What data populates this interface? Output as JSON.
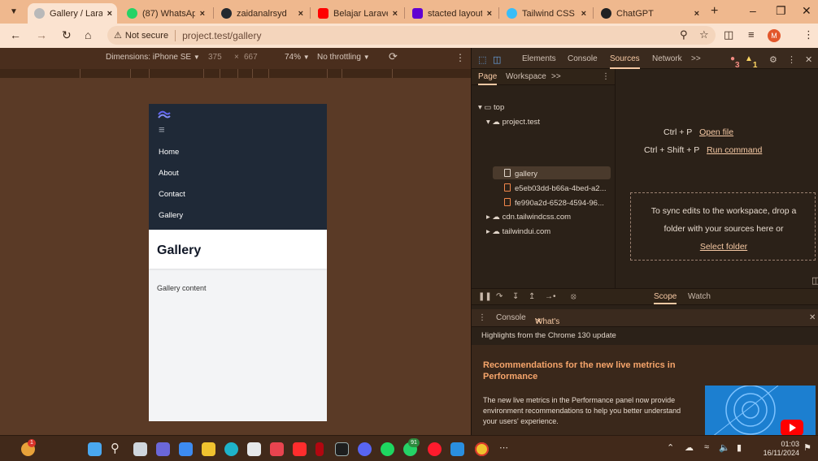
{
  "browser": {
    "tabs": [
      {
        "title": "Gallery / Larav",
        "active": true
      },
      {
        "title": "(87) WhatsAp",
        "active": false
      },
      {
        "title": "zaidanalrsyd",
        "active": false
      },
      {
        "title": "Belajar Laravel",
        "active": false
      },
      {
        "title": "stacted layout",
        "active": false
      },
      {
        "title": "Tailwind CSS",
        "active": false
      },
      {
        "title": "ChatGPT",
        "active": false
      }
    ],
    "address": {
      "security": "Not secure",
      "url": "project.test/gallery"
    },
    "profile_initial": "M"
  },
  "device_toolbar": {
    "dimensions_label": "Dimensions: iPhone SE",
    "width": "375",
    "times": "×",
    "height": "667",
    "zoom": "74%",
    "throttling": "No throttling"
  },
  "mobile_page": {
    "nav_links": [
      "Home",
      "About",
      "Contact",
      "Gallery"
    ],
    "page_title": "Gallery",
    "content": "Gallery content"
  },
  "devtools": {
    "tabs": [
      "Elements",
      "Console",
      "Sources",
      "Network"
    ],
    "more": ">>",
    "error_count": "3",
    "warning_count": "1",
    "sources_subtabs": [
      "Page",
      "Workspace"
    ],
    "tree": {
      "top": "top",
      "origin": "project.test",
      "files": [
        "gallery",
        "e5eb03dd-b66a-4bed-a2...",
        "fe990a2d-6528-4594-96..."
      ],
      "other_origins": [
        "cdn.tailwindcss.com",
        "tailwindui.com"
      ]
    },
    "editor": {
      "shortcut1_keys": "Ctrl + P",
      "shortcut1_action": "Open file",
      "shortcut2_keys": "Ctrl + Shift + P",
      "shortcut2_action": "Run command",
      "drop_line1": "To sync edits to the workspace, drop a",
      "drop_line2": "folder with your sources here or",
      "select_folder": "Select folder"
    },
    "debugger_tabs": [
      "Scope",
      "Watch"
    ],
    "drawer": {
      "tabs": [
        "Console",
        "What's new"
      ],
      "highlights": "Highlights from the Chrome 130 update",
      "card_title": "Recommendations for the new live metrics in Performance",
      "card_body": "The new live metrics in the Performance panel now provide environment recommendations to help you better understand your users' experience."
    }
  },
  "taskbar": {
    "badge_notifications": "1",
    "badge_whatsapp": "91",
    "clock_time": "01:03",
    "clock_date": "16/11/2024"
  },
  "colors": {
    "accent": "#f6c9a4",
    "nav_bg": "#1f2937",
    "tab_strip": "#efb88e"
  }
}
